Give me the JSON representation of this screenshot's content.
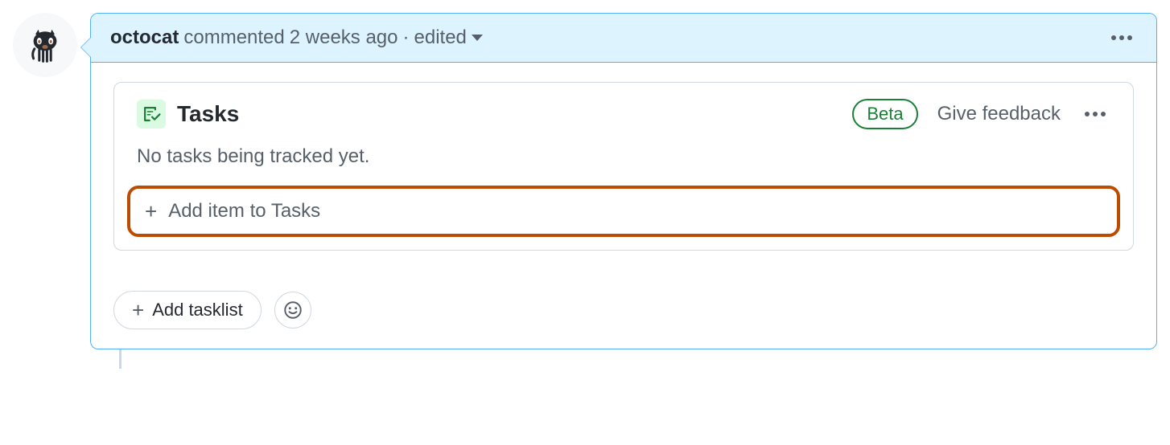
{
  "comment": {
    "author": "octocat",
    "commented_label": "commented",
    "timestamp": "2 weeks ago",
    "separator": "·",
    "edited_label": "edited"
  },
  "tasks": {
    "title": "Tasks",
    "badge": "Beta",
    "feedback_label": "Give feedback",
    "empty_message": "No tasks being tracked yet.",
    "add_item_label": "Add item to Tasks"
  },
  "footer": {
    "add_tasklist_label": "Add tasklist"
  }
}
